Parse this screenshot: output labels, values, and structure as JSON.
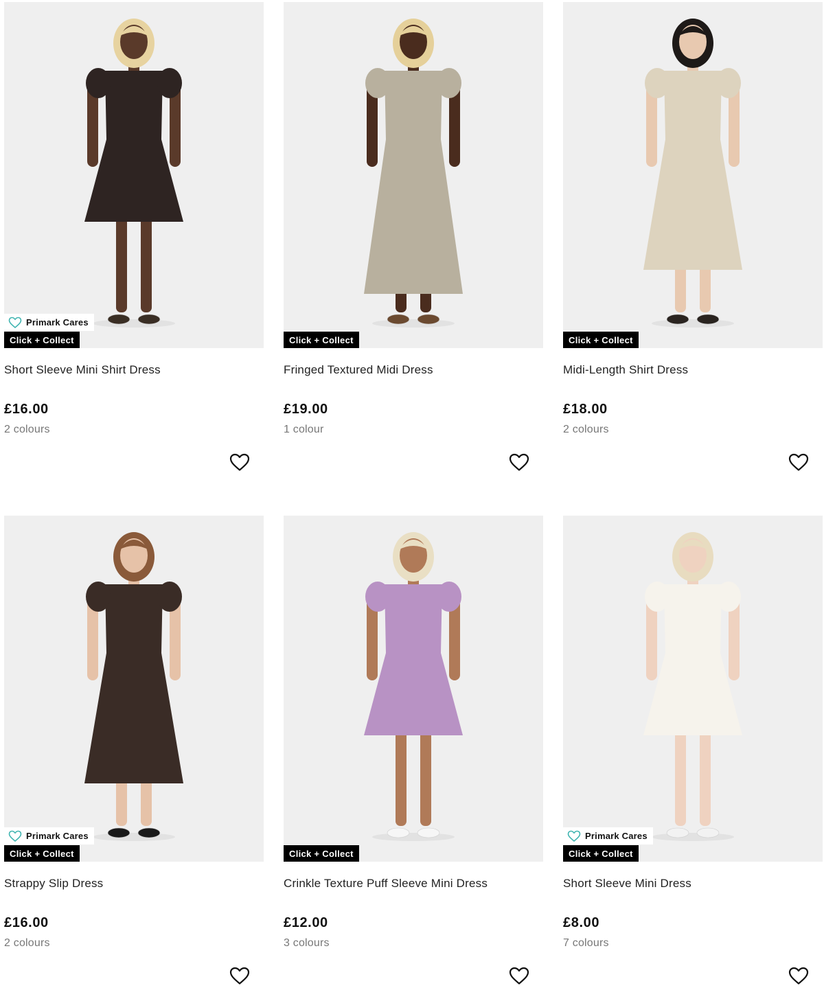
{
  "products": [
    {
      "name": "Short Sleeve Mini Shirt Dress",
      "price": "£16.00",
      "colours": "2 colours",
      "badges": {
        "cares": "Primark Cares",
        "collect": "Click + Collect"
      },
      "image": {
        "hair": "#e7d3a0",
        "skin": "#5a3a2a",
        "dress": "#2e2422",
        "dress_style": "mini",
        "shoes": "#3a2e24"
      }
    },
    {
      "name": "Fringed Textured Midi Dress",
      "price": "£19.00",
      "colours": "1 colour",
      "badges": {
        "collect": "Click + Collect"
      },
      "image": {
        "hair": "#e5d09a",
        "skin": "#4a2c1e",
        "dress": "#b8b09e",
        "dress_style": "maxi",
        "shoes": "#6b4a30"
      }
    },
    {
      "name": "Midi-Length Shirt Dress",
      "price": "£18.00",
      "colours": "2 colours",
      "badges": {
        "collect": "Click + Collect"
      },
      "image": {
        "hair": "#1e1a18",
        "skin": "#e8c9b0",
        "dress": "#ddd3be",
        "dress_style": "midi",
        "shoes": "#2a2420"
      }
    },
    {
      "name": "Strappy Slip Dress",
      "price": "£16.00",
      "colours": "2 colours",
      "badges": {
        "cares": "Primark Cares",
        "collect": "Click + Collect"
      },
      "image": {
        "hair": "#8a5a3a",
        "skin": "#e6c2a8",
        "dress": "#3a2c26",
        "dress_style": "midi",
        "shoes": "#1a1a1a"
      }
    },
    {
      "name": "Crinkle Texture Puff Sleeve Mini Dress",
      "price": "£12.00",
      "colours": "3 colours",
      "badges": {
        "collect": "Click + Collect"
      },
      "image": {
        "hair": "#e9dfc4",
        "skin": "#b07a58",
        "dress": "#b892c4",
        "dress_style": "mini",
        "shoes": "#f6f6f6"
      }
    },
    {
      "name": "Short Sleeve Mini Dress",
      "price": "£8.00",
      "colours": "7 colours",
      "badges": {
        "cares": "Primark Cares",
        "collect": "Click + Collect"
      },
      "image": {
        "hair": "#e8dcc0",
        "skin": "#efd2c0",
        "dress": "#f6f3ec",
        "dress_style": "mini",
        "shoes": "#f2f2f2"
      }
    }
  ],
  "colors": {
    "accent_cares": "#3fb4b0",
    "badge_bg": "#000000",
    "image_bg": "#efefef"
  }
}
